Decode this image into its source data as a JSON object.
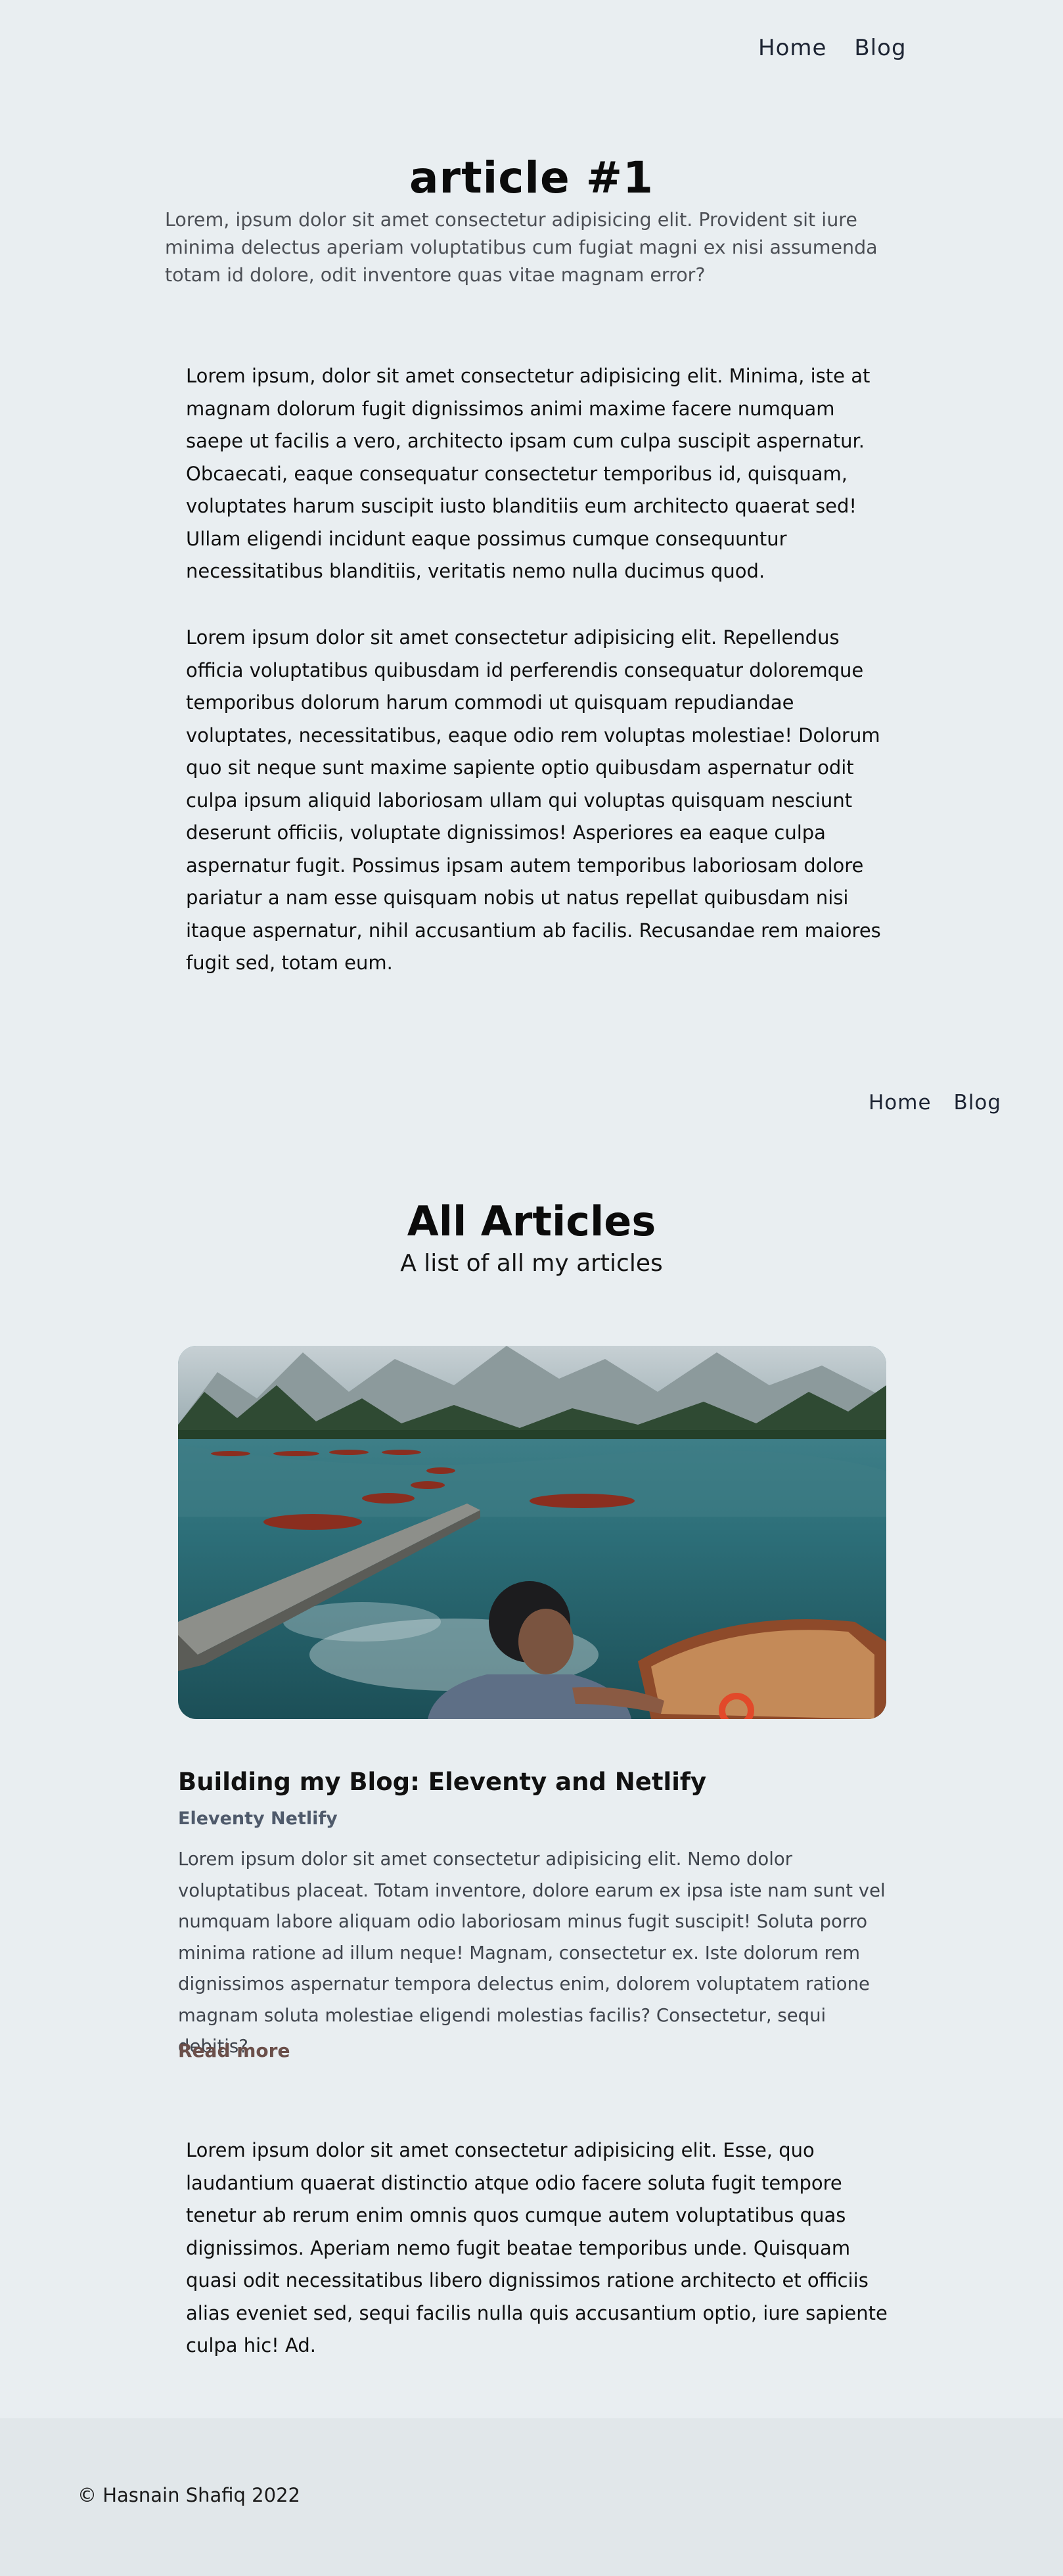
{
  "nav_top": {
    "home": "Home",
    "blog": "Blog"
  },
  "article": {
    "title": "article #1",
    "subtitle": "Lorem, ipsum dolor sit amet consectetur adipisicing elit. Provident sit iure minima delectus aperiam voluptatibus cum fugiat magni ex nisi assumenda totam id dolore, odit inventore quas vitae magnam error?",
    "paragraphs": [
      "Lorem ipsum, dolor sit amet consectetur adipisicing elit. Minima, iste at magnam dolorum fugit dignissimos animi maxime facere numquam saepe ut facilis a vero, architecto ipsam cum culpa suscipit aspernatur. Obcaecati, eaque consequatur consectetur temporibus id, quisquam, voluptates harum suscipit iusto blanditiis eum architecto quaerat sed! Ullam eligendi incidunt eaque possimus cumque consequuntur necessitatibus blanditiis, veritatis nemo nulla ducimus quod.",
      "Lorem ipsum dolor sit amet consectetur adipisicing elit. Repellendus officia voluptatibus quibusdam id perferendis consequatur doloremque temporibus dolorum harum commodi ut quisquam repudiandae voluptates, necessitatibus, eaque odio rem voluptas molestiae! Dolorum quo sit neque sunt maxime sapiente optio quibusdam aspernatur odit culpa ipsum aliquid laboriosam ullam qui voluptas quisquam nesciunt deserunt officiis, voluptate dignissimos! Asperiores ea eaque culpa aspernatur fugit. Possimus ipsam autem temporibus laboriosam dolore pariatur a nam esse quisquam nobis ut natus repellat quibusdam nisi itaque aspernatur, nihil accusantium ab facilis. Recusandae rem maiores fugit sed, totam eum."
    ]
  },
  "nav_bottom": {
    "home": "Home",
    "blog": "Blog"
  },
  "listing": {
    "title": "All Articles",
    "subtitle": "A list of all my articles",
    "posts": [
      {
        "image_icon": "lake-boats-photo",
        "title": "Building my Blog: Eleventy and Netlify",
        "tag": "Eleventy Netlify",
        "excerpt": "Lorem ipsum dolor sit amet consectetur adipisicing elit. Nemo dolor voluptatibus placeat. Totam inventore, dolore earum ex ipsa iste nam sunt vel numquam labore aliquam odio laboriosam minus fugit suscipit! Soluta porro minima ratione ad illum neque! Magnam, consectetur ex. Iste dolorum rem dignissimos aspernatur tempora delectus enim, dolorem voluptatem ratione magnam soluta molestiae eligendi molestias facilis? Consectetur, sequi debitis?",
        "read_more": "Read more"
      }
    ],
    "closing_paragraph": "Lorem ipsum dolor sit amet consectetur adipisicing elit. Esse, quo laudantium quaerat distinctio atque odio facere soluta fugit tempore tenetur ab rerum enim omnis quos cumque autem voluptatibus quas dignissimos. Aperiam nemo fugit beatae temporibus unde. Quisquam quasi odit necessitatibus libero dignissimos ratione architecto et officiis alias eveniet sed, sequi facilis nulla quis accusantium optio, iure sapiente culpa hic! Ad."
  },
  "footer": {
    "copyright": "© Hasnain Shafiq 2022"
  },
  "colors": {
    "background": "#e9eef1",
    "footer_background": "#e1e7ea",
    "read_more": "#6b4f4a",
    "tag": "#4f5a6b"
  }
}
